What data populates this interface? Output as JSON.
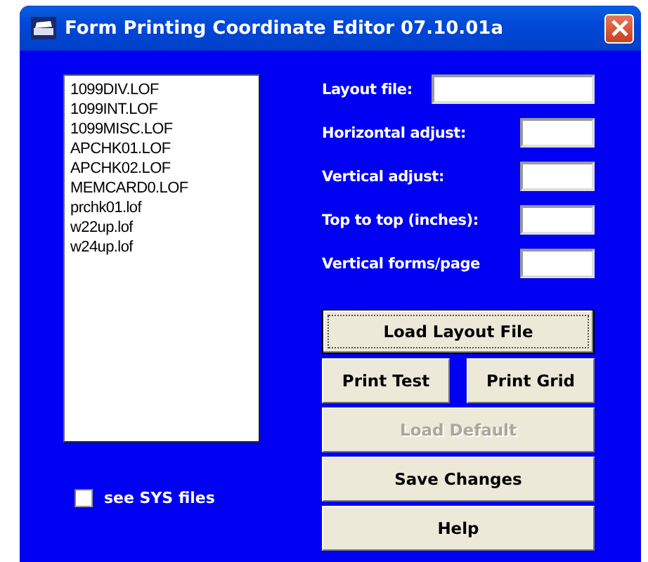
{
  "window": {
    "title": "Form Printing Coordinate Editor 07.10.01a"
  },
  "files": [
    "1099DIV.LOF",
    "1099INT.LOF",
    "1099MISC.LOF",
    "APCHK01.LOF",
    "APCHK02.LOF",
    "MEMCARD0.LOF",
    "prchk01.lof",
    "w22up.lof",
    "w24up.lof"
  ],
  "see_sys_files": {
    "label": "see SYS files",
    "checked": false
  },
  "fields": [
    {
      "label": "Layout file:",
      "kind": "wide"
    },
    {
      "label": "Horizontal adjust:",
      "kind": "short"
    },
    {
      "label": "Vertical adjust:",
      "kind": "short"
    },
    {
      "label": "Top to top (inches):",
      "kind": "short"
    },
    {
      "label": "Vertical forms/page",
      "kind": "short"
    }
  ],
  "button_rows": [
    [
      {
        "label": "Load Layout File",
        "disabled": false,
        "focused": true
      }
    ],
    [
      {
        "label": "Print Test",
        "disabled": false,
        "focused": false
      },
      {
        "label": "Print Grid",
        "disabled": false,
        "focused": false
      }
    ],
    [
      {
        "label": "Load Default",
        "disabled": true,
        "focused": false
      }
    ],
    [
      {
        "label": "Save Changes",
        "disabled": false,
        "focused": false
      }
    ],
    [
      {
        "label": "Help",
        "disabled": false,
        "focused": false
      }
    ]
  ]
}
